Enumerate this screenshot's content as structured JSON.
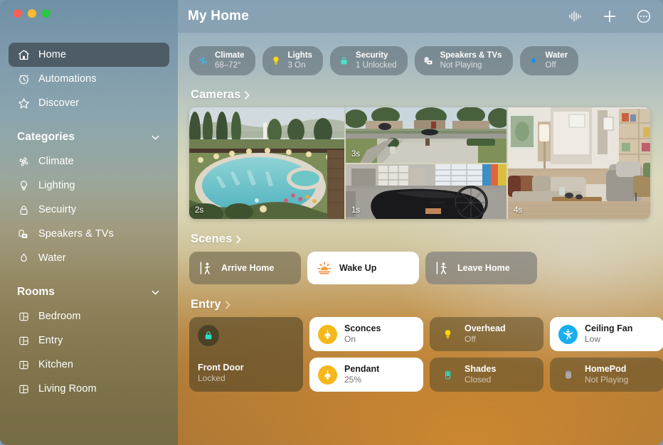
{
  "window": {
    "traffic_lights": [
      "close",
      "minimize",
      "zoom"
    ],
    "colors": {
      "close": "#ff5f57",
      "minimize": "#febc2e",
      "zoom": "#28c840"
    }
  },
  "titlebar": {
    "title": "My Home",
    "actions": [
      {
        "name": "audio-waveform-icon",
        "label": "Audio"
      },
      {
        "name": "plus-icon",
        "label": "Add"
      },
      {
        "name": "more-ellipsis-icon",
        "label": "More"
      }
    ]
  },
  "sidebar": {
    "top_items": [
      {
        "label": "Home",
        "icon": "house-icon",
        "selected": true
      },
      {
        "label": "Automations",
        "icon": "clock-icon",
        "selected": false
      },
      {
        "label": "Discover",
        "icon": "star-icon",
        "selected": false
      }
    ],
    "categories": {
      "title": "Categories",
      "collapsed": false,
      "items": [
        {
          "label": "Climate",
          "icon": "fan-icon"
        },
        {
          "label": "Lighting",
          "icon": "bulb-icon"
        },
        {
          "label": "Secuirty",
          "icon": "lock-icon"
        },
        {
          "label": "Speakers & TVs",
          "icon": "speaker-tv-icon"
        },
        {
          "label": "Water",
          "icon": "droplet-icon"
        }
      ]
    },
    "rooms": {
      "title": "Rooms",
      "collapsed": false,
      "items": [
        {
          "label": "Bedroom",
          "icon": "room-icon"
        },
        {
          "label": "Entry",
          "icon": "room-icon"
        },
        {
          "label": "Kitchen",
          "icon": "room-icon"
        },
        {
          "label": "Living Room",
          "icon": "room-icon"
        }
      ]
    }
  },
  "status_pills": [
    {
      "name": "Climate",
      "state": "68–72°",
      "icon": "fan-icon",
      "icon_color": "#3bb7e8"
    },
    {
      "name": "Lights",
      "state": "3 On",
      "icon": "bulb-icon",
      "icon_color": "#ffd60a"
    },
    {
      "name": "Security",
      "state": "1 Unlocked",
      "icon": "lock-icon",
      "icon_color": "#49e3c8"
    },
    {
      "name": "Speakers & TVs",
      "state": "Not Playing",
      "icon": "speaker-tv-icon",
      "icon_color": "#e9e9e9"
    },
    {
      "name": "Water",
      "state": "Off",
      "icon": "droplet-icon",
      "icon_color": "#1b8cf0"
    }
  ],
  "cameras": {
    "title": "Cameras",
    "tiles": [
      {
        "name": "pool-camera",
        "badge": "2s",
        "scene": "backyard-pool"
      },
      {
        "name": "driveway-camera",
        "badge": "3s",
        "scene": "street-driveway"
      },
      {
        "name": "garage-camera",
        "badge": "1s",
        "scene": "garage-bike"
      },
      {
        "name": "living-room-camera",
        "badge": "4s",
        "scene": "living-room"
      }
    ]
  },
  "scenes": {
    "title": "Scenes",
    "items": [
      {
        "label": "Arrive Home",
        "icon": "person-arrive-icon",
        "active": false,
        "style": "a"
      },
      {
        "label": "Wake Up",
        "icon": "sunrise-icon",
        "active": true,
        "style": "active"
      },
      {
        "label": "Leave Home",
        "icon": "person-leave-icon",
        "active": false,
        "style": "b"
      }
    ]
  },
  "entry": {
    "title": "Entry",
    "front_door": {
      "name": "Front Door",
      "state": "Locked",
      "icon": "lock-icon",
      "icon_color": "#2ae0c8"
    },
    "accessories": [
      {
        "name": "Sconces",
        "state": "On",
        "icon": "pendant-lamp-icon",
        "on": true,
        "icon_bg": "#f5b81c"
      },
      {
        "name": "Overhead",
        "state": "Off",
        "icon": "bulb-icon",
        "on": false,
        "icon_bg": "transparent"
      },
      {
        "name": "Ceiling Fan",
        "state": "Low",
        "icon": "ceiling-fan-icon",
        "on": true,
        "icon_bg": "#19aeef"
      },
      {
        "name": "Pendant",
        "state": "25%",
        "icon": "pendant-lamp-icon",
        "on": true,
        "icon_bg": "#f5b81c"
      },
      {
        "name": "Shades",
        "state": "Closed",
        "icon": "shade-icon",
        "on": false,
        "icon_bg": "transparent"
      },
      {
        "name": "HomePod",
        "state": "Not Playing",
        "icon": "homepod-icon",
        "on": false,
        "icon_bg": "transparent"
      }
    ]
  }
}
